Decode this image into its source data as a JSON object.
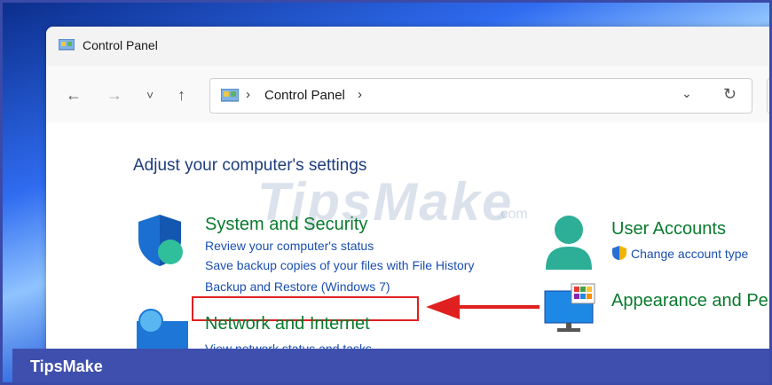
{
  "window": {
    "title": "Control Panel"
  },
  "address_bar": {
    "path": "Control Panel",
    "separator": "›"
  },
  "nav_glyphs": {
    "back": "←",
    "forward": "→",
    "recent": "˅",
    "up": "↑",
    "dropdown": "⌄",
    "refresh": "↻"
  },
  "content": {
    "heading": "Adjust your computer's settings",
    "watermark": "TipsMake",
    "watermark_suffix": ".com",
    "categories": [
      {
        "title": "System and Security",
        "icon": "shield-icon",
        "links": [
          "Review your computer's status",
          "Save backup copies of your files with File History",
          "Backup and Restore (Windows 7)"
        ]
      },
      {
        "title": "Network and Internet",
        "icon": "globe-monitor-icon",
        "links": [
          "View network status and tasks"
        ]
      },
      {
        "title": "User Accounts",
        "icon": "user-icon",
        "links": [
          "Change account type"
        ]
      },
      {
        "title": "Appearance and Per",
        "icon": "monitor-icon",
        "links": []
      }
    ]
  },
  "footer": {
    "brand": "TipsMake"
  },
  "colors": {
    "heading": "#1e3d7b",
    "category": "#0a7a2e",
    "link": "#1a4fb0",
    "highlight": "#e02020",
    "footer": "#3f4fae"
  }
}
